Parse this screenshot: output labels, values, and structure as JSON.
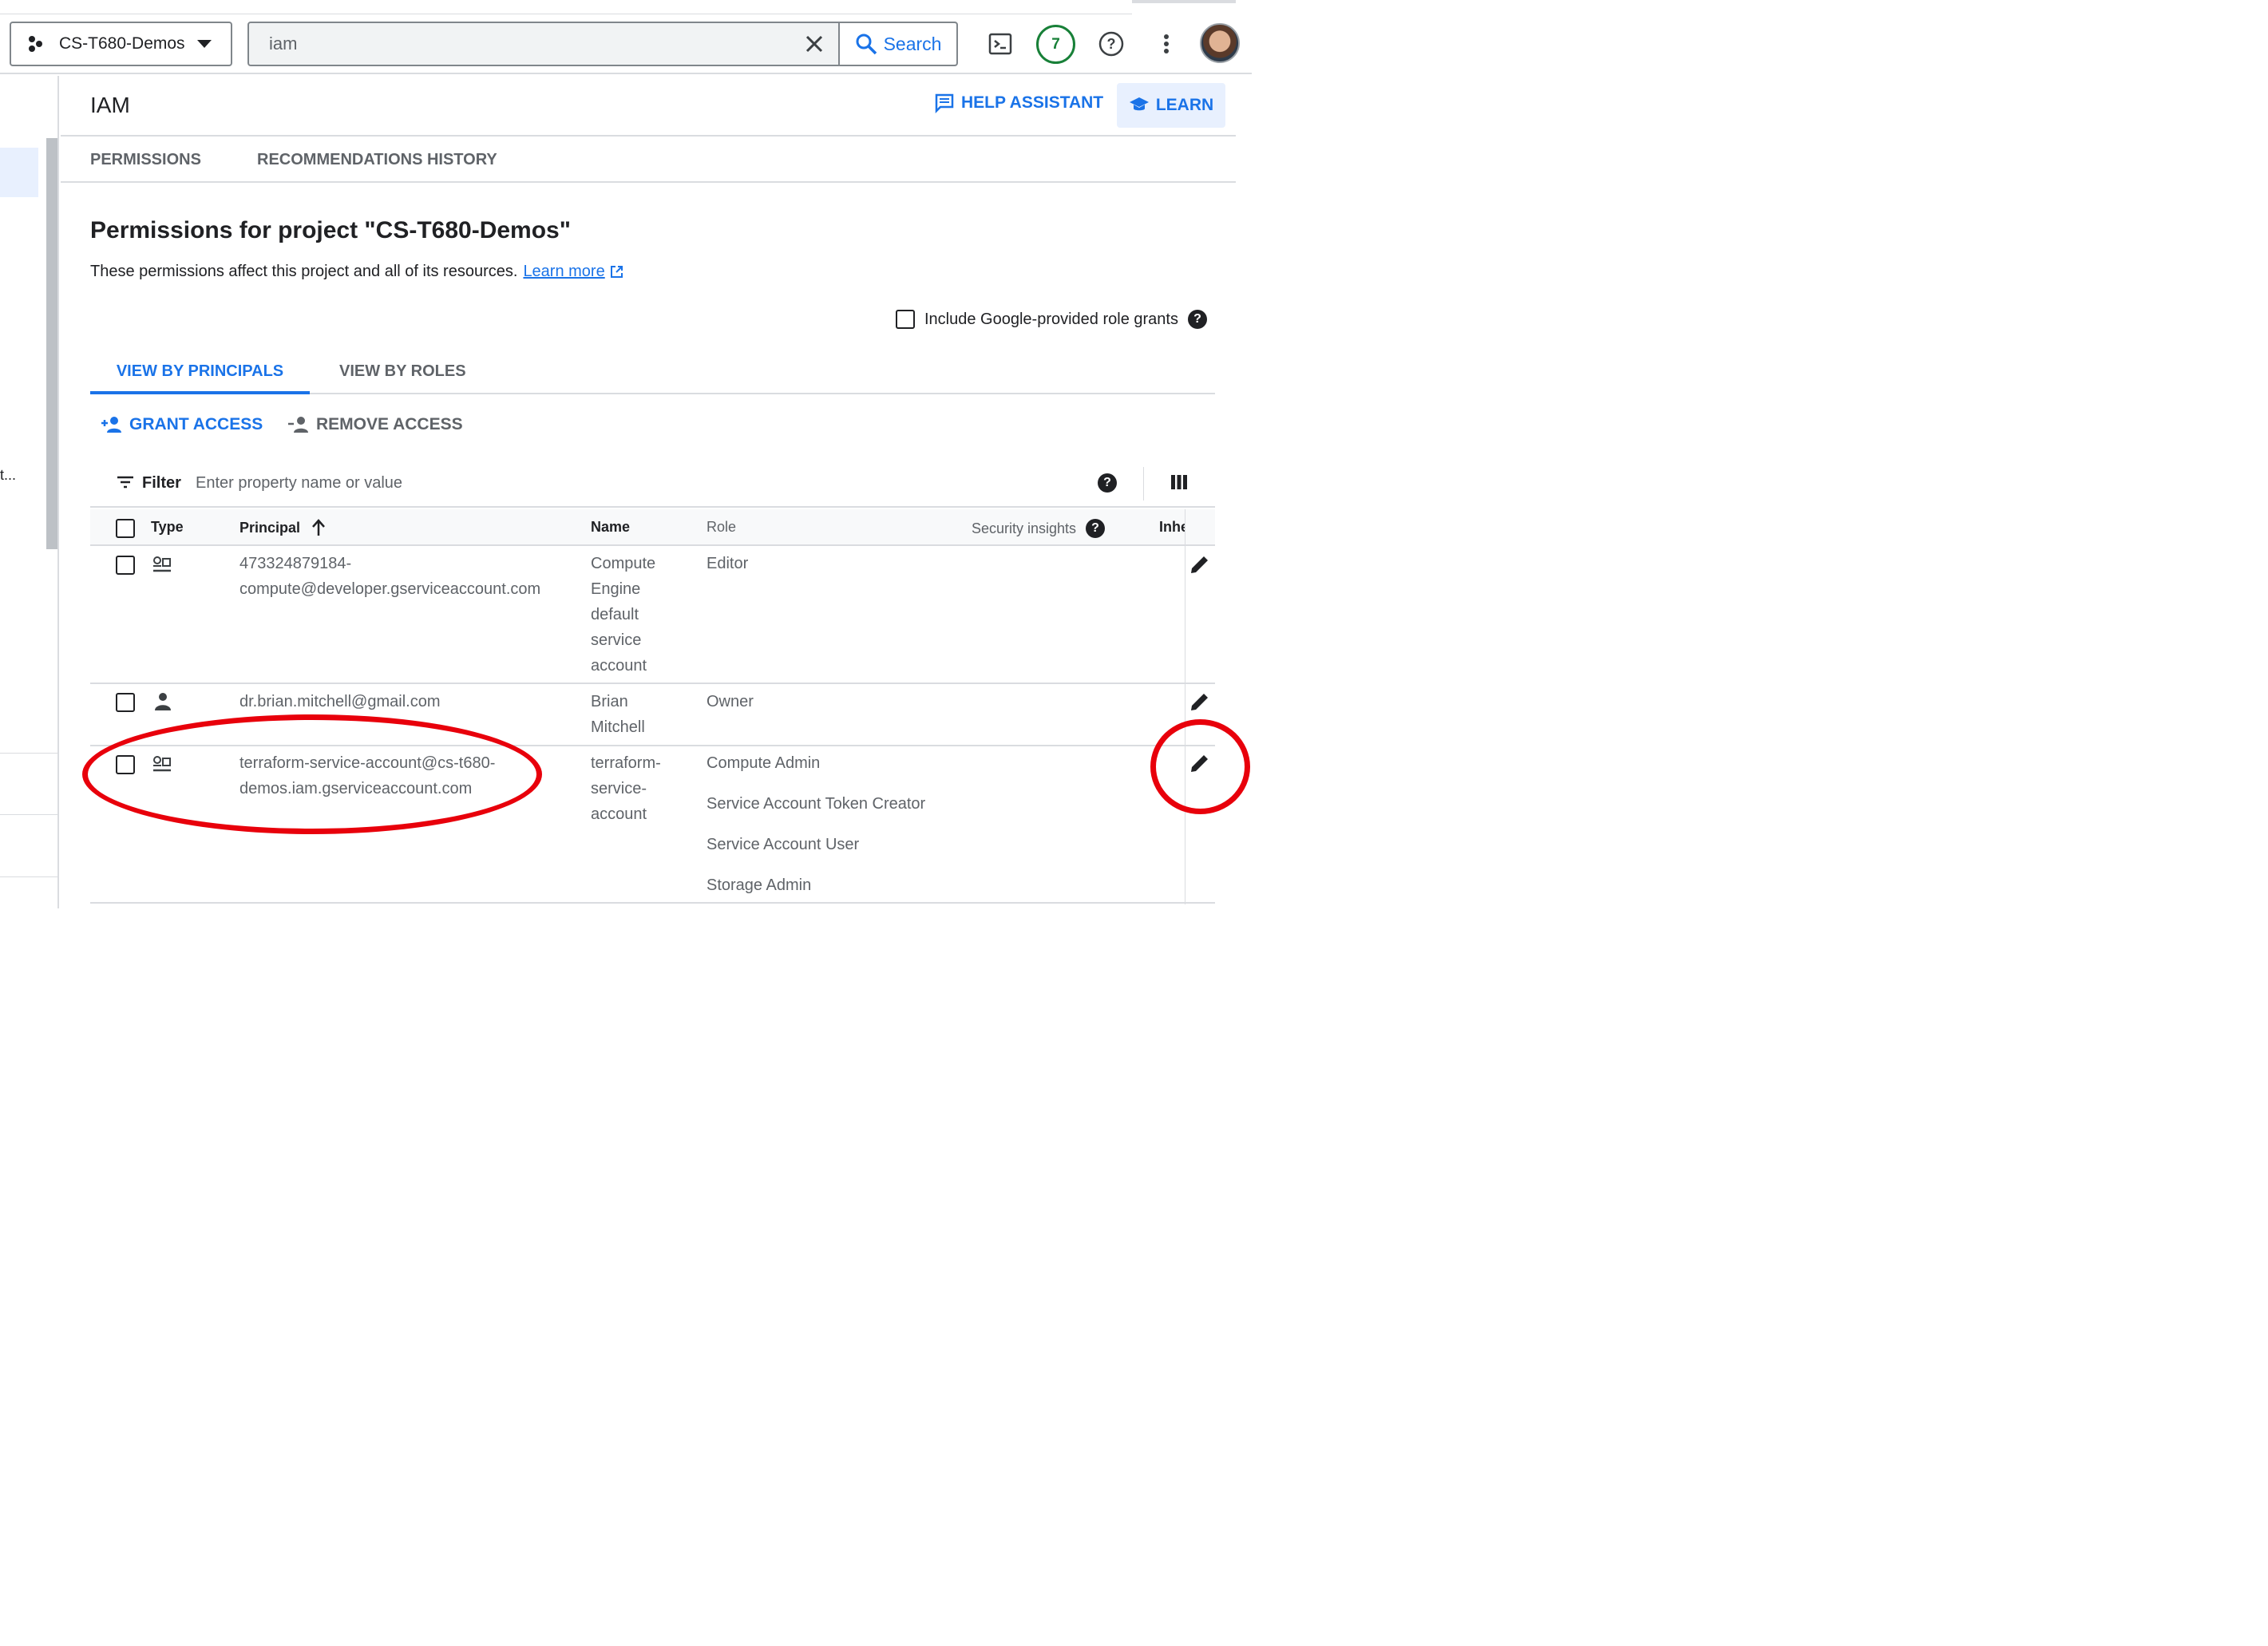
{
  "topbar": {
    "project_name": "CS-T680-Demos",
    "search_value": "iam",
    "search_button": "Search",
    "notifications_count": "7"
  },
  "nav": {
    "truncated_item": "t..."
  },
  "header": {
    "title": "IAM",
    "help_assistant": "HELP ASSISTANT",
    "learn": "LEARN"
  },
  "tabs": [
    "PERMISSIONS",
    "RECOMMENDATIONS HISTORY"
  ],
  "permissions": {
    "title": "Permissions for project \"CS-T680-Demos\"",
    "description": "These permissions affect this project and all of its resources.",
    "learn_more": "Learn more",
    "include_google_label": "Include Google-provided role grants"
  },
  "view_tabs": {
    "principals": "VIEW BY PRINCIPALS",
    "roles": "VIEW BY ROLES"
  },
  "actions": {
    "grant": "GRANT ACCESS",
    "remove": "REMOVE ACCESS"
  },
  "filter": {
    "label": "Filter",
    "placeholder": "Enter property name or value"
  },
  "table": {
    "columns": {
      "type": "Type",
      "principal": "Principal",
      "name": "Name",
      "role": "Role",
      "security_insights": "Security insights",
      "inheritance": "Inhe"
    },
    "rows": [
      {
        "type_icon": "service-account-icon",
        "principal_lines": [
          "473324879184-",
          "compute@developer.gserviceaccount.com"
        ],
        "name_lines": [
          "Compute",
          "Engine",
          "default",
          "service",
          "account"
        ],
        "roles": [
          "Editor"
        ]
      },
      {
        "type_icon": "person-icon",
        "principal_lines": [
          "dr.brian.mitchell@gmail.com"
        ],
        "name_lines": [
          "Brian",
          "Mitchell"
        ],
        "roles": [
          "Owner"
        ]
      },
      {
        "type_icon": "service-account-icon",
        "principal_lines": [
          "terraform-service-account@cs-t680-",
          "demos.iam.gserviceaccount.com"
        ],
        "name_lines": [
          "terraform-",
          "service-",
          "account"
        ],
        "roles": [
          "Compute Admin",
          "Service Account Token Creator",
          "Service Account User",
          "Storage Admin"
        ]
      }
    ]
  },
  "colors": {
    "accent": "#1a73e8",
    "annotation": "#e8000b",
    "badge": "#188038"
  }
}
